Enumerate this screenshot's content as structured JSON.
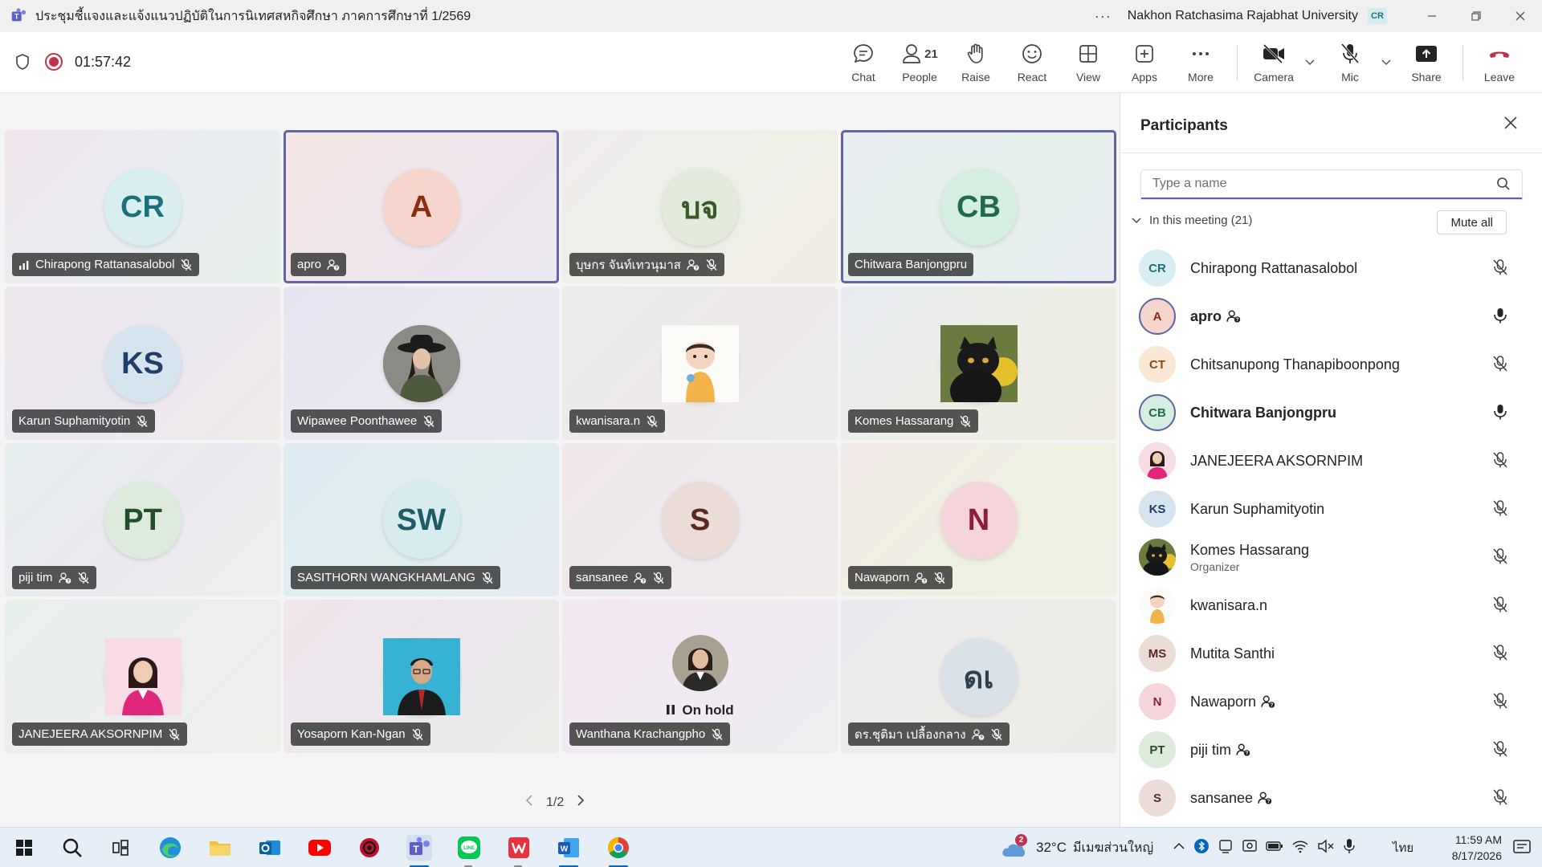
{
  "window": {
    "title": "ประชุมชี้แจงและแจ้งแนวปฏิบัติในการนิเทศสหกิจศึกษา ภาคการศึกษาที่ 1/2569",
    "org": "Nakhon Ratchasima Rajabhat University",
    "me_initials": "CR",
    "more": "···"
  },
  "toolbar": {
    "timer": "01:57:42",
    "people_count": "21",
    "buttons": {
      "chat": "Chat",
      "people": "People",
      "raise": "Raise",
      "react": "React",
      "view": "View",
      "apps": "Apps",
      "more": "More",
      "camera": "Camera",
      "mic": "Mic",
      "share": "Share",
      "leave": "Leave"
    }
  },
  "tiles": [
    {
      "name": "Chirapong Rattanasalobol",
      "initials": "CR",
      "bg": "#d9eef0",
      "fg": "#1e6f7c"
    },
    {
      "name": "apro",
      "initials": "A",
      "bg": "#f6d6cc",
      "fg": "#8a2c10"
    },
    {
      "name": "บุษกร จันท์เทวนุมาส",
      "initials": "บจ",
      "bg": "#e3ecdc",
      "fg": "#3b5a2a"
    },
    {
      "name": "Chitwara Banjongpru",
      "initials": "CB",
      "bg": "#d4eee2",
      "fg": "#1f6b4a"
    },
    {
      "name": "Karun Suphamityotin",
      "initials": "KS",
      "bg": "#d6e4f0",
      "fg": "#1f3f68"
    },
    {
      "name": "Wipawee Poonthawee"
    },
    {
      "name": "kwanisara.n"
    },
    {
      "name": "Komes Hassarang"
    },
    {
      "name": "piji tim",
      "initials": "PT",
      "bg": "#dcebdc",
      "fg": "#234e2a"
    },
    {
      "name": "SASITHORN WANGKHAMLANG",
      "initials": "SW",
      "bg": "#d7ecee",
      "fg": "#1d5c66"
    },
    {
      "name": "sansanee",
      "initials": "S",
      "bg": "#ecdcd8",
      "fg": "#5a2a1e"
    },
    {
      "name": "Nawaporn",
      "initials": "N",
      "bg": "#f6d4dc",
      "fg": "#8a1f3a"
    },
    {
      "name": "JANEJEERA AKSORNPIM"
    },
    {
      "name": "Yosaporn Kan-Ngan"
    },
    {
      "name": "Wanthana Krachangpho",
      "status": "On hold"
    },
    {
      "name": "ดร.ชุติมา เปลื้องกลาง",
      "initials": "ดเ",
      "bg": "#d9e2e8",
      "fg": "#2e4150"
    }
  ],
  "pager": "1/2",
  "participants": {
    "title": "Participants",
    "search_placeholder": "Type a name",
    "section": "In this meeting (21)",
    "mute_all": "Mute all",
    "list": [
      {
        "name": "Chirapong Rattanasalobol",
        "initials": "CR"
      },
      {
        "name": "apro",
        "initials": "A"
      },
      {
        "name": "Chitsanupong Thanapiboonpong",
        "initials": "CT"
      },
      {
        "name": "Chitwara Banjongpru",
        "initials": "CB"
      },
      {
        "name": "JANEJEERA AKSORNPIM"
      },
      {
        "name": "Karun Suphamityotin",
        "initials": "KS"
      },
      {
        "name": "Komes Hassarang",
        "role": "Organizer"
      },
      {
        "name": "kwanisara.n"
      },
      {
        "name": "Mutita Santhi",
        "initials": "MS"
      },
      {
        "name": "Nawaporn",
        "initials": "N"
      },
      {
        "name": "piji tim",
        "initials": "PT"
      },
      {
        "name": "sansanee",
        "initials": "S"
      }
    ]
  },
  "taskbar": {
    "weather_badge": "2",
    "temperature": "32°C",
    "weather": "มีเมฆส่วนใหญ่",
    "lang": "ไทย",
    "time": "11:59 AM",
    "date": "8/17/2026"
  },
  "colors": {
    "accent": "#5b5fc7",
    "record": "#c4314b",
    "leave": "#c4314b"
  }
}
